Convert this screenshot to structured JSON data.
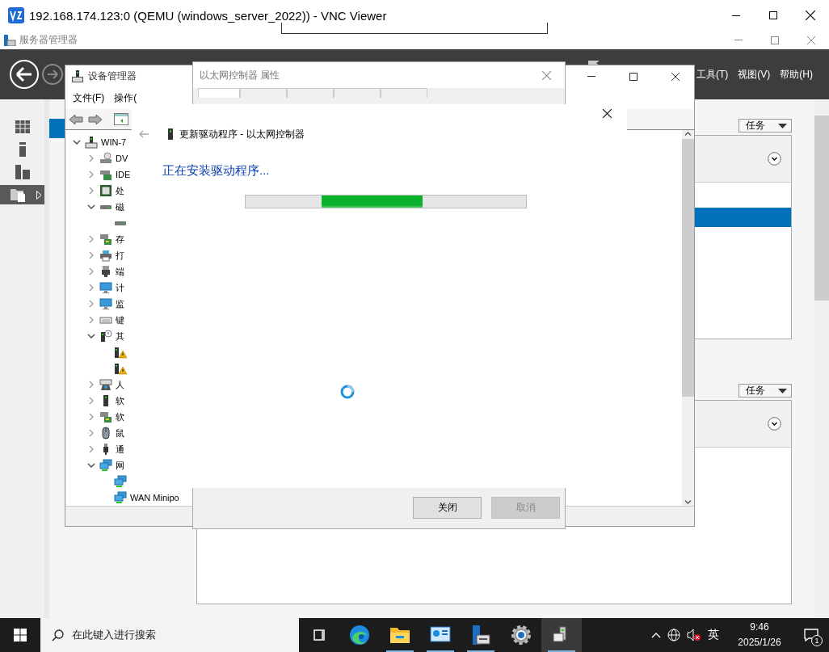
{
  "vnc": {
    "title": "192.168.174.123:0 (QEMU (windows_server_2022)) - VNC Viewer"
  },
  "server_manager": {
    "title": "服务器管理器",
    "menu": [
      "工具(T)",
      "视图(V)",
      "帮助(H)"
    ],
    "nav": [
      {
        "kind": "dashboard",
        "selected": false
      },
      {
        "kind": "local",
        "selected": false
      },
      {
        "kind": "all",
        "selected": false
      },
      {
        "kind": "files",
        "selected": true
      }
    ],
    "panels": [
      {
        "task_button": "任务"
      },
      {
        "task_button": "任务"
      }
    ]
  },
  "device_manager": {
    "title": "设备管理器",
    "menu": [
      "文件(F)",
      "操作("
    ],
    "tree": {
      "label": "WIN-7",
      "kind": "computer",
      "expanded": true,
      "children": [
        {
          "label": "DV",
          "kind": "dvd",
          "expanded": false
        },
        {
          "label": "IDE",
          "kind": "ide",
          "expanded": false
        },
        {
          "label": "处",
          "kind": "cpu",
          "expanded": false
        },
        {
          "label": "磁",
          "kind": "disk",
          "expanded": true,
          "children": [
            {
              "kind": "disk"
            }
          ]
        },
        {
          "label": "存",
          "kind": "storage",
          "expanded": false
        },
        {
          "label": "打",
          "kind": "printer",
          "expanded": false
        },
        {
          "label": "端",
          "kind": "port",
          "expanded": false
        },
        {
          "label": "计",
          "kind": "monitor",
          "expanded": false
        },
        {
          "label": "监",
          "kind": "monitor",
          "expanded": false
        },
        {
          "label": "键",
          "kind": "keyboard",
          "expanded": false
        },
        {
          "label": "其",
          "kind": "other",
          "expanded": true,
          "children": [
            {
              "kind": "warning"
            },
            {
              "kind": "warning"
            }
          ]
        },
        {
          "label": "人",
          "kind": "hid",
          "expanded": false
        },
        {
          "label": "软",
          "kind": "software",
          "expanded": false
        },
        {
          "label": "软",
          "kind": "storage",
          "expanded": false
        },
        {
          "label": "鼠",
          "kind": "mouse",
          "expanded": false
        },
        {
          "label": "通",
          "kind": "usb",
          "expanded": false
        },
        {
          "label": "网",
          "kind": "network",
          "expanded": true,
          "children": [
            {
              "kind": "network"
            },
            {
              "kind": "network",
              "label": "WAN Minipo"
            }
          ]
        }
      ]
    }
  },
  "properties": {
    "title": "以太网控制器 属性",
    "buttons": [
      {
        "label": "关闭",
        "disabled": false
      },
      {
        "label": "取消",
        "disabled": true
      }
    ]
  },
  "driver_dialog": {
    "heading": "更新驱动程序 - 以太网控制器",
    "status": "正在安装驱动程序...",
    "progress": {
      "indeterminate": true
    }
  },
  "taskbar": {
    "search_placeholder": "在此键入进行搜索",
    "apps": [
      {
        "kind": "taskview",
        "running": false,
        "selected": false
      },
      {
        "kind": "edge",
        "running": false,
        "selected": false
      },
      {
        "kind": "explorer",
        "running": true,
        "selected": false
      },
      {
        "kind": "chart",
        "running": true,
        "selected": false
      },
      {
        "kind": "server",
        "running": true,
        "selected": false
      },
      {
        "kind": "gear",
        "running": false,
        "selected": false
      },
      {
        "kind": "devmgr",
        "running": true,
        "selected": true
      }
    ],
    "ime": "英",
    "time": "9:46",
    "date": "2025/1/26",
    "notifications": "1"
  }
}
